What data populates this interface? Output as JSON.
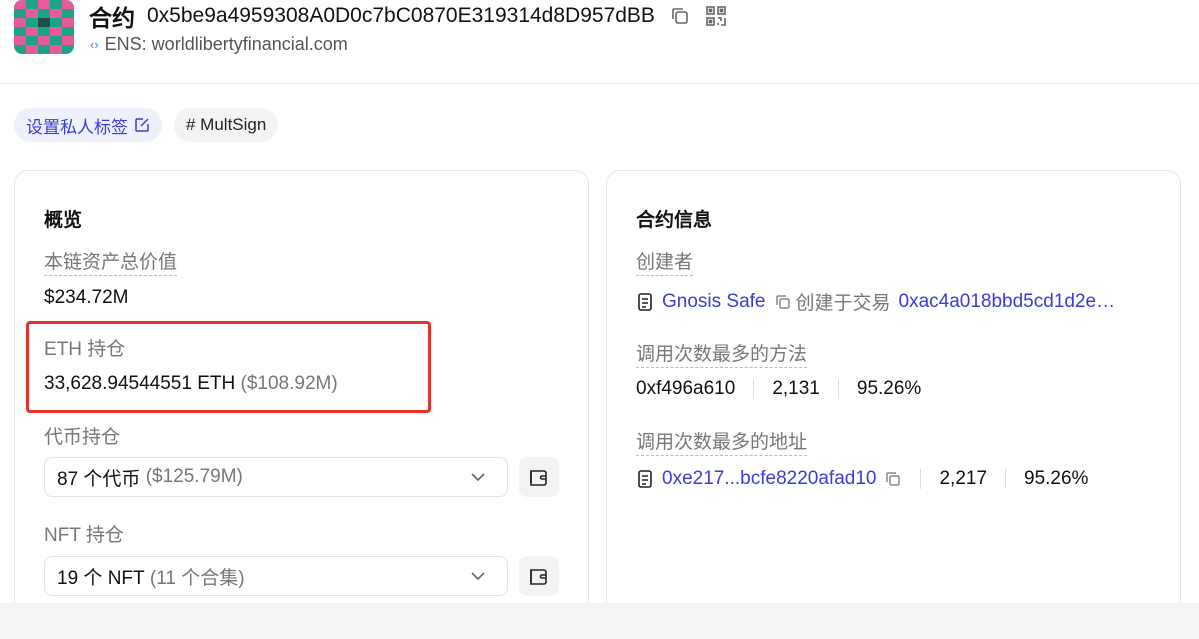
{
  "header": {
    "label": "合约",
    "address": "0x5be9a4959308A0D0c7bC0870E319314d8D957dBB",
    "ens": "ENS: worldlibertyfinancial.com",
    "icons": [
      "copy-icon",
      "qr-code-icon"
    ]
  },
  "tags": {
    "private": "设置私人标签",
    "hash": "# MultSign"
  },
  "overview": {
    "title": "概览",
    "total_label": "本链资产总价值",
    "total_value": "$234.72M",
    "eth_label": "ETH 持仓",
    "eth_amount": "33,628.94544551 ETH",
    "eth_usd": "($108.92M)",
    "token_label": "代币持仓",
    "token_count": "87 个代币",
    "token_usd": "($125.79M)",
    "nft_label": "NFT 持仓",
    "nft_count": "19 个 NFT",
    "nft_sets": "(11 个合集)"
  },
  "contract_info": {
    "title": "合约信息",
    "creator_label": "创建者",
    "creator_name": "Gnosis Safe",
    "created_in": "创建于交易",
    "tx_hash": "0xac4a018bbd5cd1d2e…",
    "method_label": "调用次数最多的方法",
    "method_id": "0xf496a610",
    "method_count": "2,131",
    "method_pct": "95.26%",
    "address_label": "调用次数最多的地址",
    "top_address": "0xe217...bcfe8220afad10",
    "address_count": "2,217",
    "address_pct": "95.26%"
  },
  "colors": {
    "accent": "#3b3bd6",
    "highlight": "#e8302b",
    "avatar_primary": "#1aa387",
    "avatar_secondary": "#e85a9a"
  }
}
